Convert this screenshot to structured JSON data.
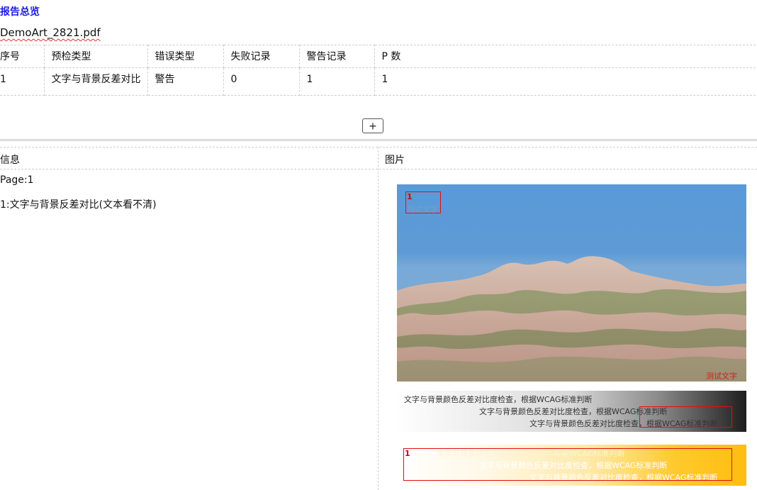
{
  "report_title": "报告总览",
  "file_name": "DemoArt_2821.pdf",
  "summary_table": {
    "headers": [
      "序号",
      "预检类型",
      "错误类型",
      "失败记录",
      "警告记录",
      "P 数"
    ],
    "rows": [
      [
        "1",
        "文字与背景反差对比",
        "警告",
        "0",
        "1",
        "1"
      ]
    ]
  },
  "add_button_label": "+",
  "detail": {
    "info_header": "信息",
    "image_header": "图片",
    "page_label": "Page:1",
    "issue_text": "1:文字与背景反差对比(文本看不清)"
  },
  "preview": {
    "photo_marker_number": "1",
    "photo_sample_text": "测试文字",
    "photo_corner_text": "测试文字",
    "gradient_sample_lines": [
      "文字与背景颜色反差对比度检查，根据WCAG标准判断",
      "文字与背景颜色反差对比度检查，根据WCAG标准判断",
      "文字与背景颜色反差对比度检查，根据WCAG标准判断"
    ],
    "yellow_marker_number": "1",
    "yellow_sample_lines": [
      "文字与背景颜色反差对比度检查，根据WCAG标准判断",
      "文字与背景颜色反差对比度检查，根据WCAG标准判断",
      "文字与背景颜色反差对比度检查，根据WCAG标准判断"
    ],
    "marker_color": "#e01010"
  },
  "colors": {
    "title_blue": "#1a1ae6",
    "spellcheck_red": "#e03030"
  }
}
